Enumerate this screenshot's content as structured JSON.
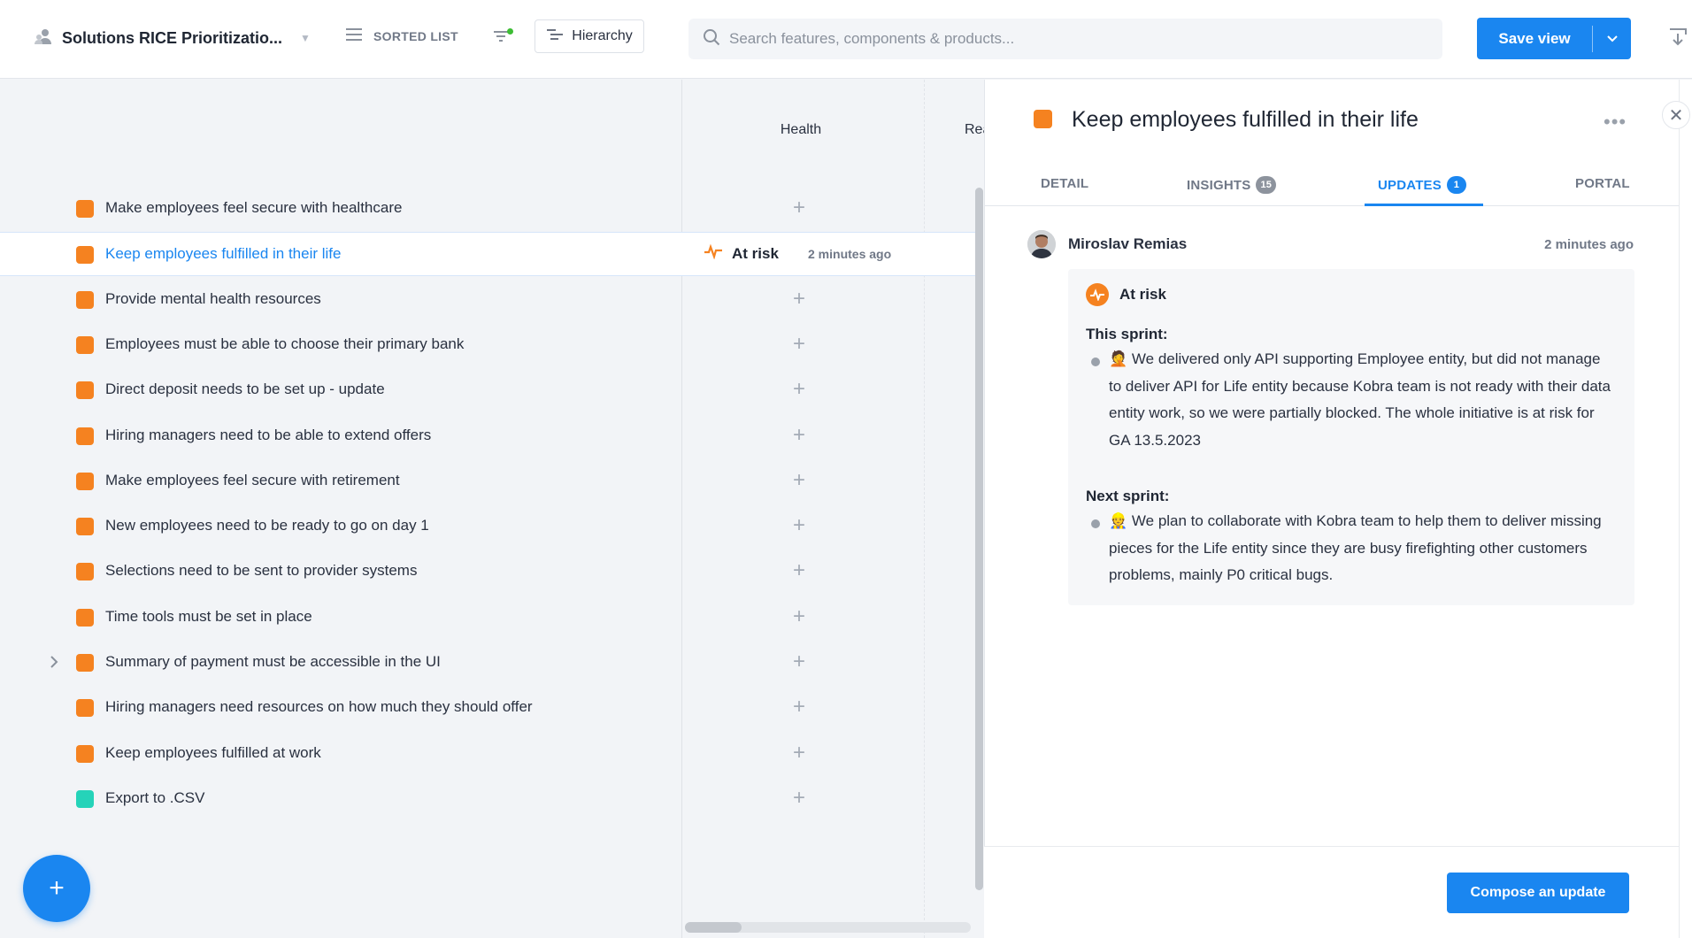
{
  "header": {
    "view_title": "Solutions RICE Prioritizatio...",
    "sorted_list_label": "SORTED LIST",
    "hierarchy_label": "Hierarchy",
    "search_placeholder": "Search features, components & products...",
    "save_view_label": "Save view"
  },
  "columns": {
    "health": "Health",
    "next": "Rea"
  },
  "rows": [
    {
      "name": "Make employees feel secure with healthcare",
      "color": "#f58220"
    },
    {
      "name": "Keep employees fulfilled in their life",
      "color": "#f58220",
      "selected": true,
      "health": "At risk",
      "health_time": "2 minutes ago"
    },
    {
      "name": "Provide mental health resources",
      "color": "#f58220"
    },
    {
      "name": "Employees must be able to choose their primary bank",
      "color": "#f58220"
    },
    {
      "name": "Direct deposit needs to be set up - update",
      "color": "#f58220"
    },
    {
      "name": "Hiring managers need to be able to extend offers",
      "color": "#f58220"
    },
    {
      "name": "Make employees feel secure with retirement",
      "color": "#f58220"
    },
    {
      "name": "New employees need to be ready to go on day 1",
      "color": "#f58220"
    },
    {
      "name": "Selections need to be sent to provider systems",
      "color": "#f58220"
    },
    {
      "name": "Time tools must be set in place",
      "color": "#f58220"
    },
    {
      "name": "Summary of payment must be accessible in the UI",
      "color": "#f58220",
      "expandable": true
    },
    {
      "name": "Hiring managers need resources on how much they should offer",
      "color": "#f58220"
    },
    {
      "name": "Keep employees fulfilled at work",
      "color": "#f58220"
    },
    {
      "name": "Export to .CSV",
      "color": "#25d3b9"
    }
  ],
  "add_icon": "plus-icon",
  "panel": {
    "title": "Keep employees fulfilled in their life",
    "tabs": [
      {
        "label": "DETAIL",
        "badge": ""
      },
      {
        "label": "INSIGHTS",
        "badge": "15"
      },
      {
        "label": "UPDATES",
        "badge": "1",
        "active": true
      },
      {
        "label": "PORTAL",
        "badge": ""
      }
    ],
    "update": {
      "author": "Miroslav Remias",
      "time": "2 minutes ago",
      "status": "At risk",
      "this_sprint_heading": "This sprint:",
      "this_sprint_emoji": "🤦",
      "this_sprint_text": "We delivered only API supporting Employee entity, but did not manage to deliver API for Life entity because Kobra team is not ready with their data entity work, so we were partially blocked. The whole initiative is at risk for GA 13.5.2023",
      "next_sprint_heading": "Next sprint:",
      "next_sprint_emoji": "👷",
      "next_sprint_text": "We plan to collaborate with Kobra team to help them to deliver missing pieces for the Life entity since they are busy firefighting other customers problems, mainly P0 critical bugs."
    },
    "compose_label": "Compose an update"
  },
  "colors": {
    "accent": "#1a86f0",
    "orange": "#f58220",
    "teal": "#25d3b9",
    "filter_active": "#3dbd34"
  }
}
